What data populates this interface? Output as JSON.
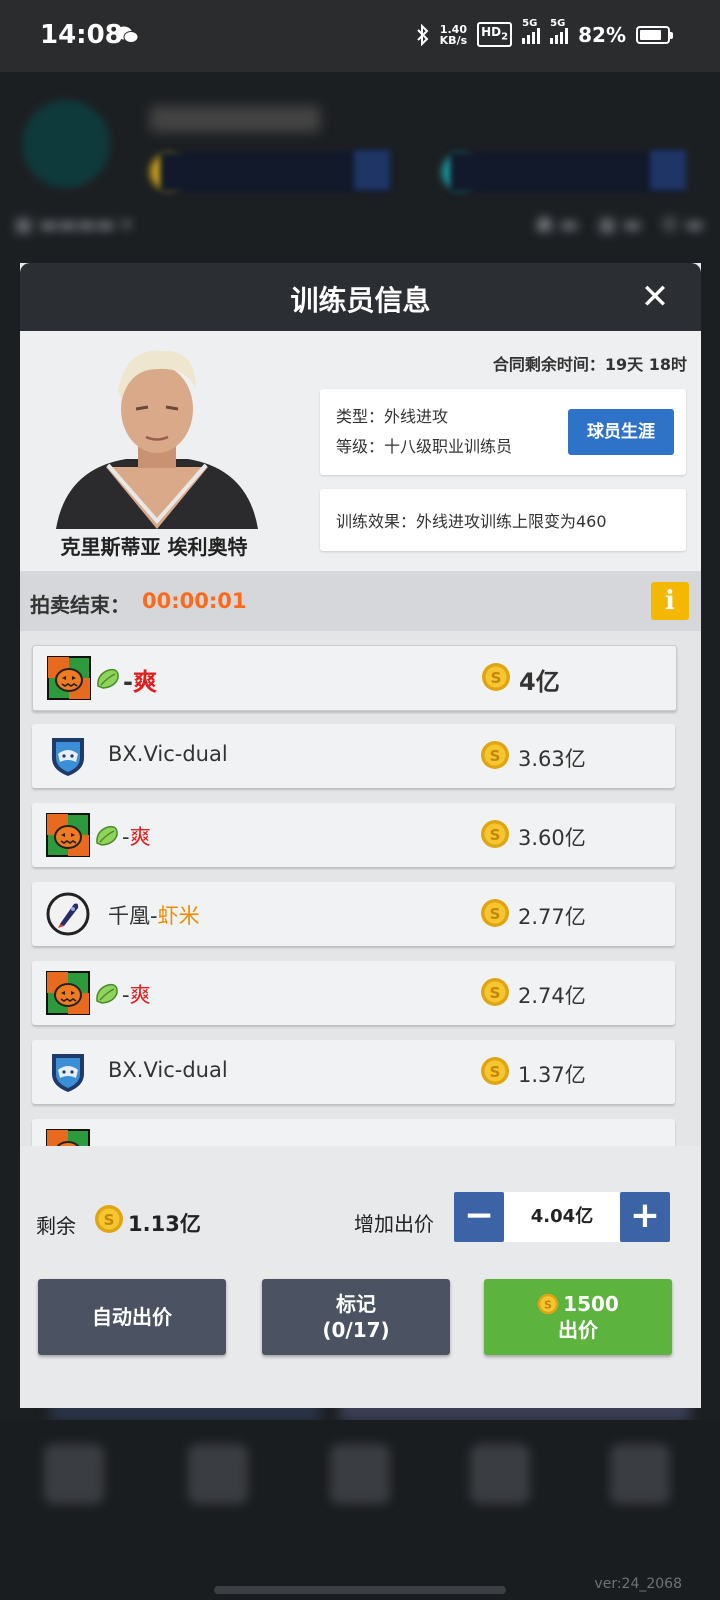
{
  "status_bar": {
    "time": "14:08",
    "net_speed_value": "1.40",
    "net_speed_unit": "KB/s",
    "hd": "HD",
    "hd_sub": "2",
    "sig1": "5G",
    "sig2": "5G",
    "battery": "82%",
    "battery_level": 0.82
  },
  "modal": {
    "title": "训练员信息",
    "close": "✕",
    "coach": {
      "name": "克里斯蒂亚 埃利奥特",
      "contract": "合同剩余时间：19天 18时",
      "type": "类型：外线进攻",
      "level": "等级：十八级职业训练员",
      "career_button": "球员生涯",
      "effect": "训练效果：外线进攻训练上限变为460"
    },
    "auction": {
      "label": "拍卖结束：",
      "time": "00:00:01",
      "info": "i"
    },
    "bids": [
      {
        "logo": "pumpkin-logo",
        "prefix": "-",
        "name": "爽",
        "name_color": "red",
        "amount": "4亿"
      },
      {
        "logo": "shield-logo",
        "prefix": "BX.Vic-dual",
        "name": "",
        "name_color": "",
        "amount": "3.63亿"
      },
      {
        "logo": "pumpkin-logo",
        "prefix": "-",
        "name": "爽",
        "name_color": "red",
        "amount": "3.60亿"
      },
      {
        "logo": "rocket-logo",
        "prefix": "千凰-",
        "name": "虾米",
        "name_color": "orange",
        "amount": "2.77亿"
      },
      {
        "logo": "pumpkin-logo",
        "prefix": "-",
        "name": "爽",
        "name_color": "red",
        "amount": "2.74亿"
      },
      {
        "logo": "shield-logo",
        "prefix": "BX.Vic-dual",
        "name": "",
        "name_color": "",
        "amount": "1.37亿"
      }
    ],
    "footer": {
      "remain_label": "剩余",
      "remain_value": "1.13亿",
      "raise_label": "增加出价",
      "minus": "−",
      "plus": "+",
      "raise_value": "4.04亿",
      "auto_bid": "自动出价",
      "mark_label": "标记",
      "mark_count": "(0/17)",
      "bid_cost": "1500",
      "bid_label": "出价"
    }
  },
  "background": {
    "version": "ver:24_2068"
  }
}
